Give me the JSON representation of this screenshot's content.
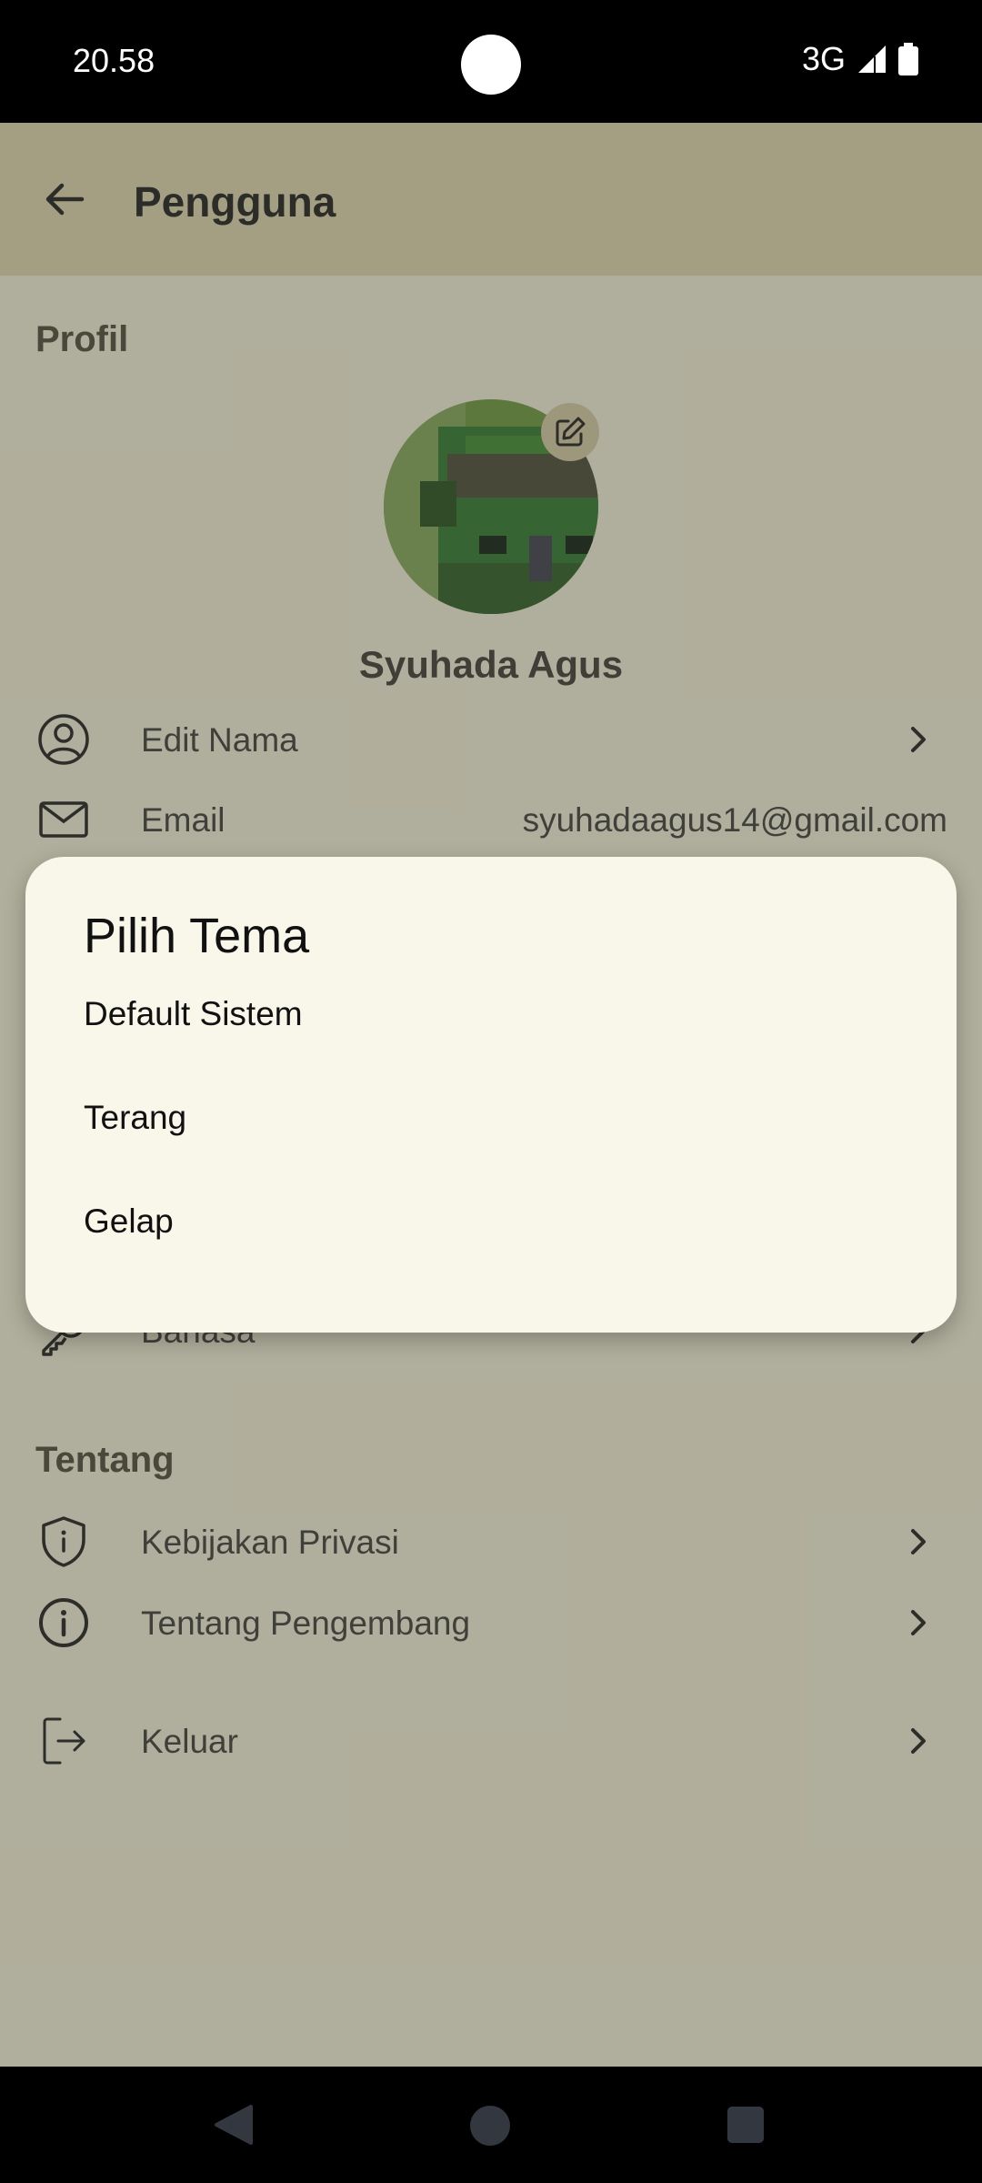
{
  "status_bar": {
    "time": "20.58",
    "network": "3G"
  },
  "header": {
    "title": "Pengguna",
    "back_icon": "arrow-left-icon"
  },
  "profile": {
    "section_title": "Profil",
    "user_name": "Syuhada Agus",
    "edit_avatar_icon": "edit-icon"
  },
  "settings_rows": [
    {
      "label": "Edit Nama",
      "icon": "person-circle-icon"
    },
    {
      "label": "Email",
      "value": "syuhadaagus14@gmail.com",
      "icon": "mail-icon"
    },
    {
      "label": "Bahasa",
      "icon": "key-icon"
    }
  ],
  "about": {
    "section_title": "Tentang",
    "items": [
      {
        "label": "Kebijakan Privasi",
        "icon": "shield-info-icon"
      },
      {
        "label": "Tentang Pengembang",
        "icon": "info-circle-icon"
      }
    ]
  },
  "logout": {
    "label": "Keluar",
    "icon": "logout-icon"
  },
  "dialog": {
    "title": "Pilih Tema",
    "options": [
      "Default Sistem",
      "Terang",
      "Gelap"
    ]
  },
  "colors": {
    "app_background": "#fefae0",
    "top_bar": "#e9e1b5",
    "dialog_background": "#f9f6ea",
    "scrim": "#46443e"
  }
}
